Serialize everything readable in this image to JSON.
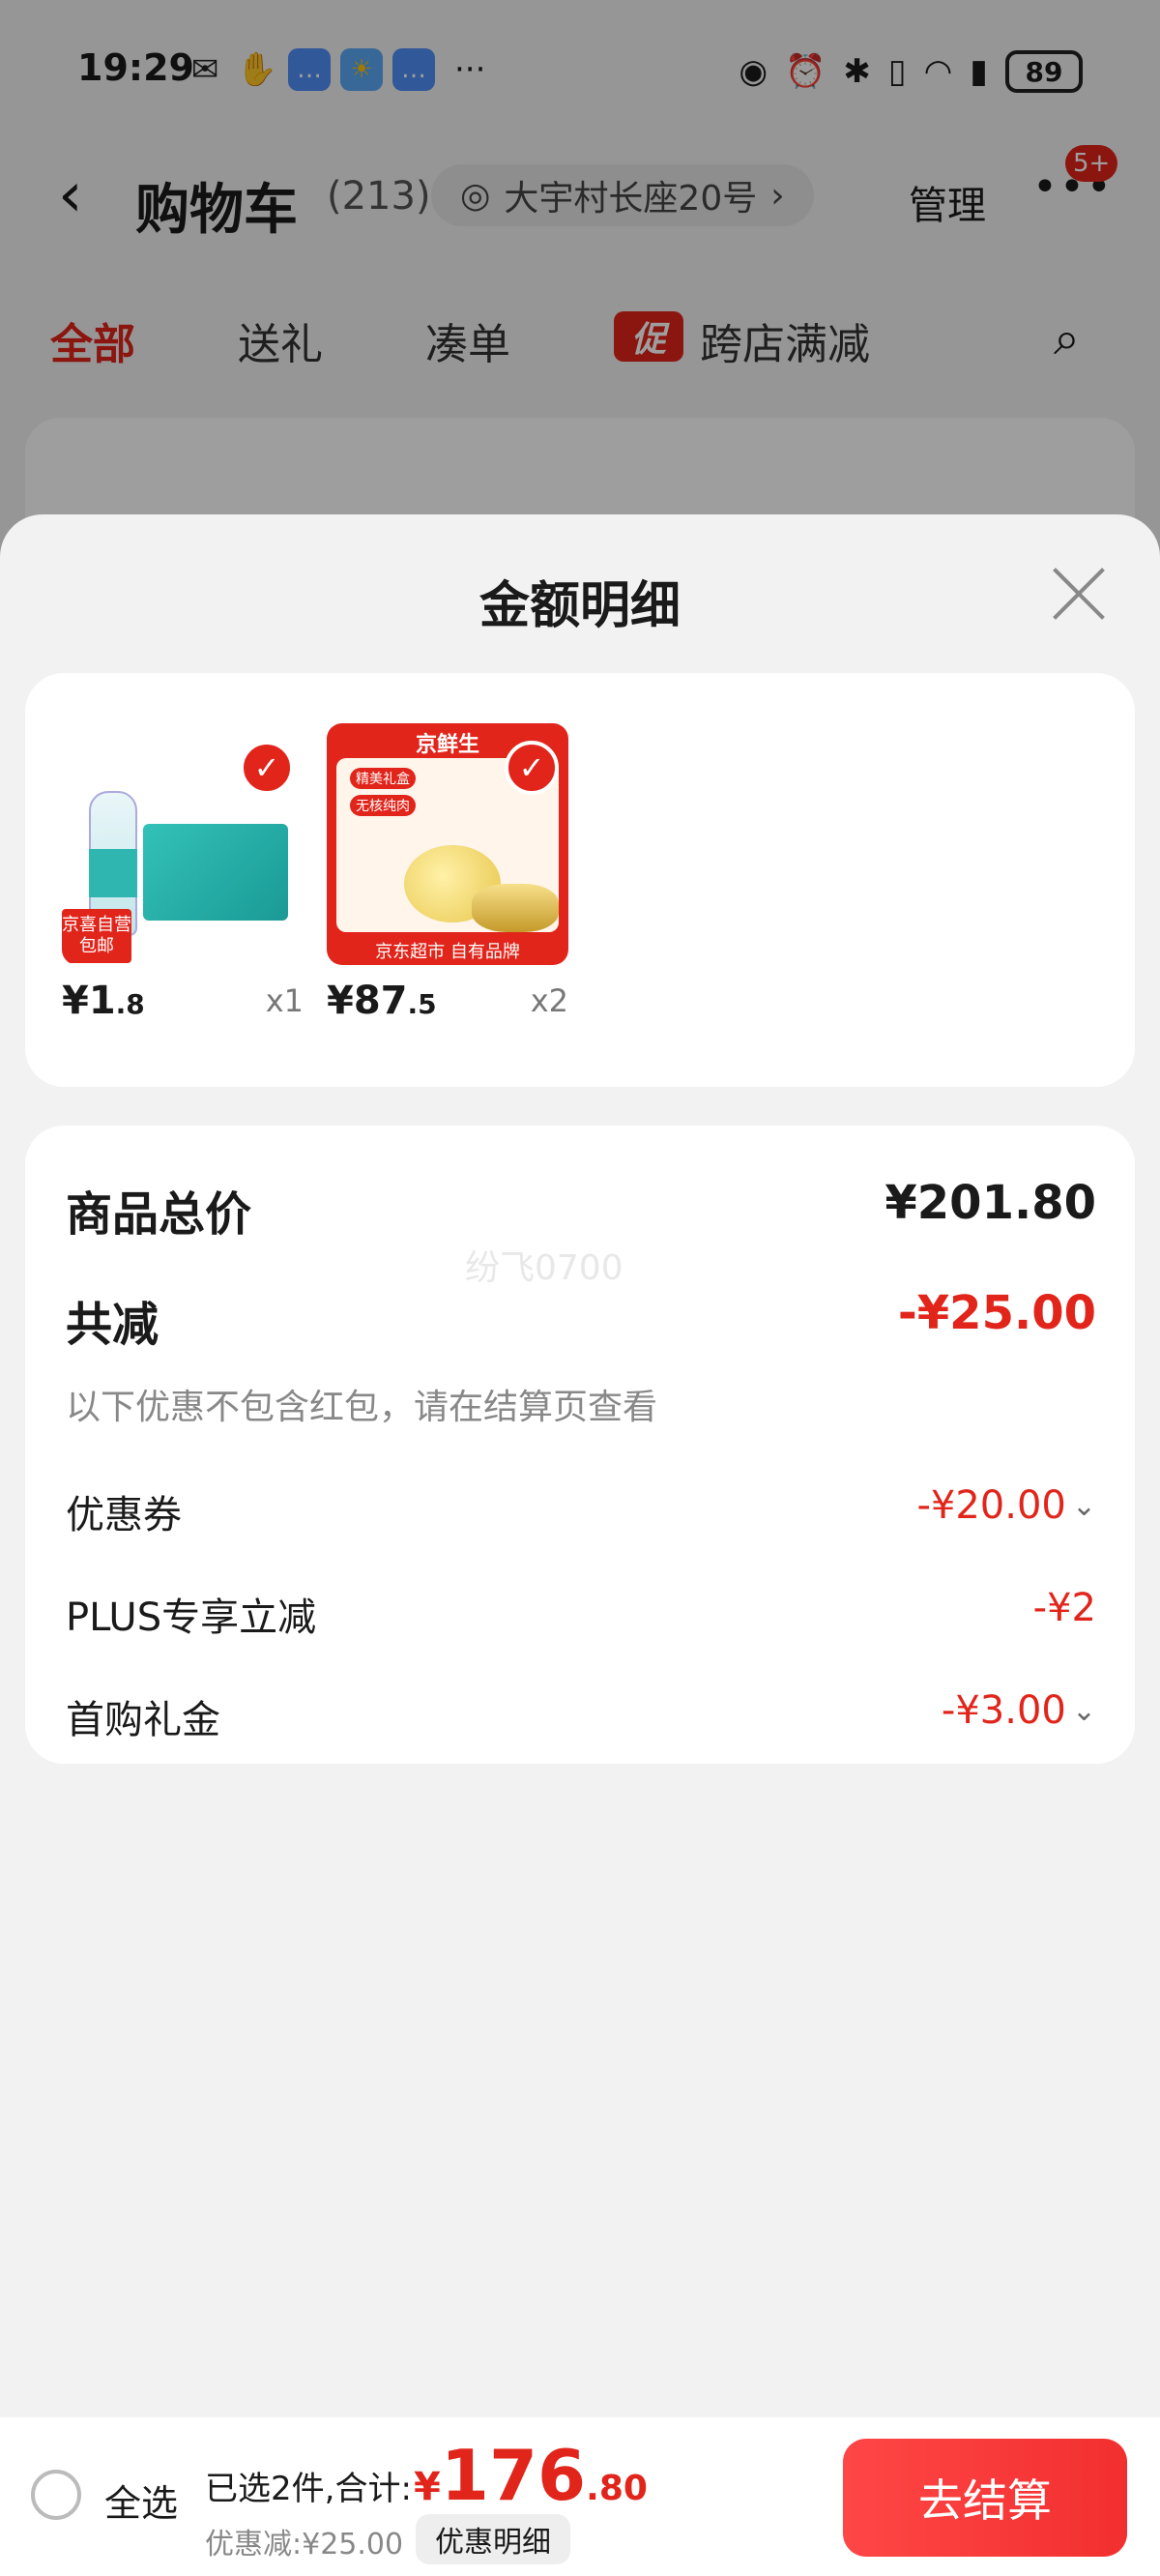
{
  "status_bar": {
    "time": "19:29",
    "battery": "89",
    "more_dots": "···"
  },
  "nav": {
    "back_icon": "‹",
    "title": "购物车",
    "count": "(213)",
    "address": "大宇村长座20号",
    "address_chevron": "›",
    "manage": "管理",
    "more_icon": "•••",
    "badge": "5+"
  },
  "tabs": {
    "all": "全部",
    "gift": "送礼",
    "combine": "凑单",
    "promo_badge": "促",
    "cross_store": "跨店满减"
  },
  "sheet": {
    "title": "金额明细",
    "products": [
      {
        "price_int": "¥1",
        "price_dec": ".8",
        "qty": "x1",
        "tag_line1": "京喜自营",
        "tag_line2": "包邮"
      },
      {
        "price_int": "¥87",
        "price_dec": ".5",
        "qty": "x2",
        "brand": "京鲜生",
        "chip1": "精美礼盒",
        "chip2": "无核纯肉",
        "footer": "京东超市 自有品牌"
      }
    ],
    "summary": {
      "total_label": "商品总价",
      "total_value": "¥201.80",
      "watermark": "纷飞0700",
      "reduce_label": "共减",
      "reduce_value": "-¥25.00",
      "note": "以下优惠不包含红包，请在结算页查看",
      "lines": [
        {
          "label": "优惠券",
          "value": "-¥20.00"
        },
        {
          "label": "PLUS专享立减",
          "value": "-¥2"
        },
        {
          "label": "首购礼金",
          "value": "-¥3.00"
        }
      ]
    }
  },
  "footer": {
    "select_all": "全选",
    "selected": "已选2件,合计:",
    "total_yen": "¥",
    "total_int": "176",
    "total_dec": ".80",
    "discount": "优惠减:¥25.00",
    "detail_button": "优惠明细",
    "checkout_button": "去结算"
  },
  "colors": {
    "accent": "#e1251b"
  }
}
